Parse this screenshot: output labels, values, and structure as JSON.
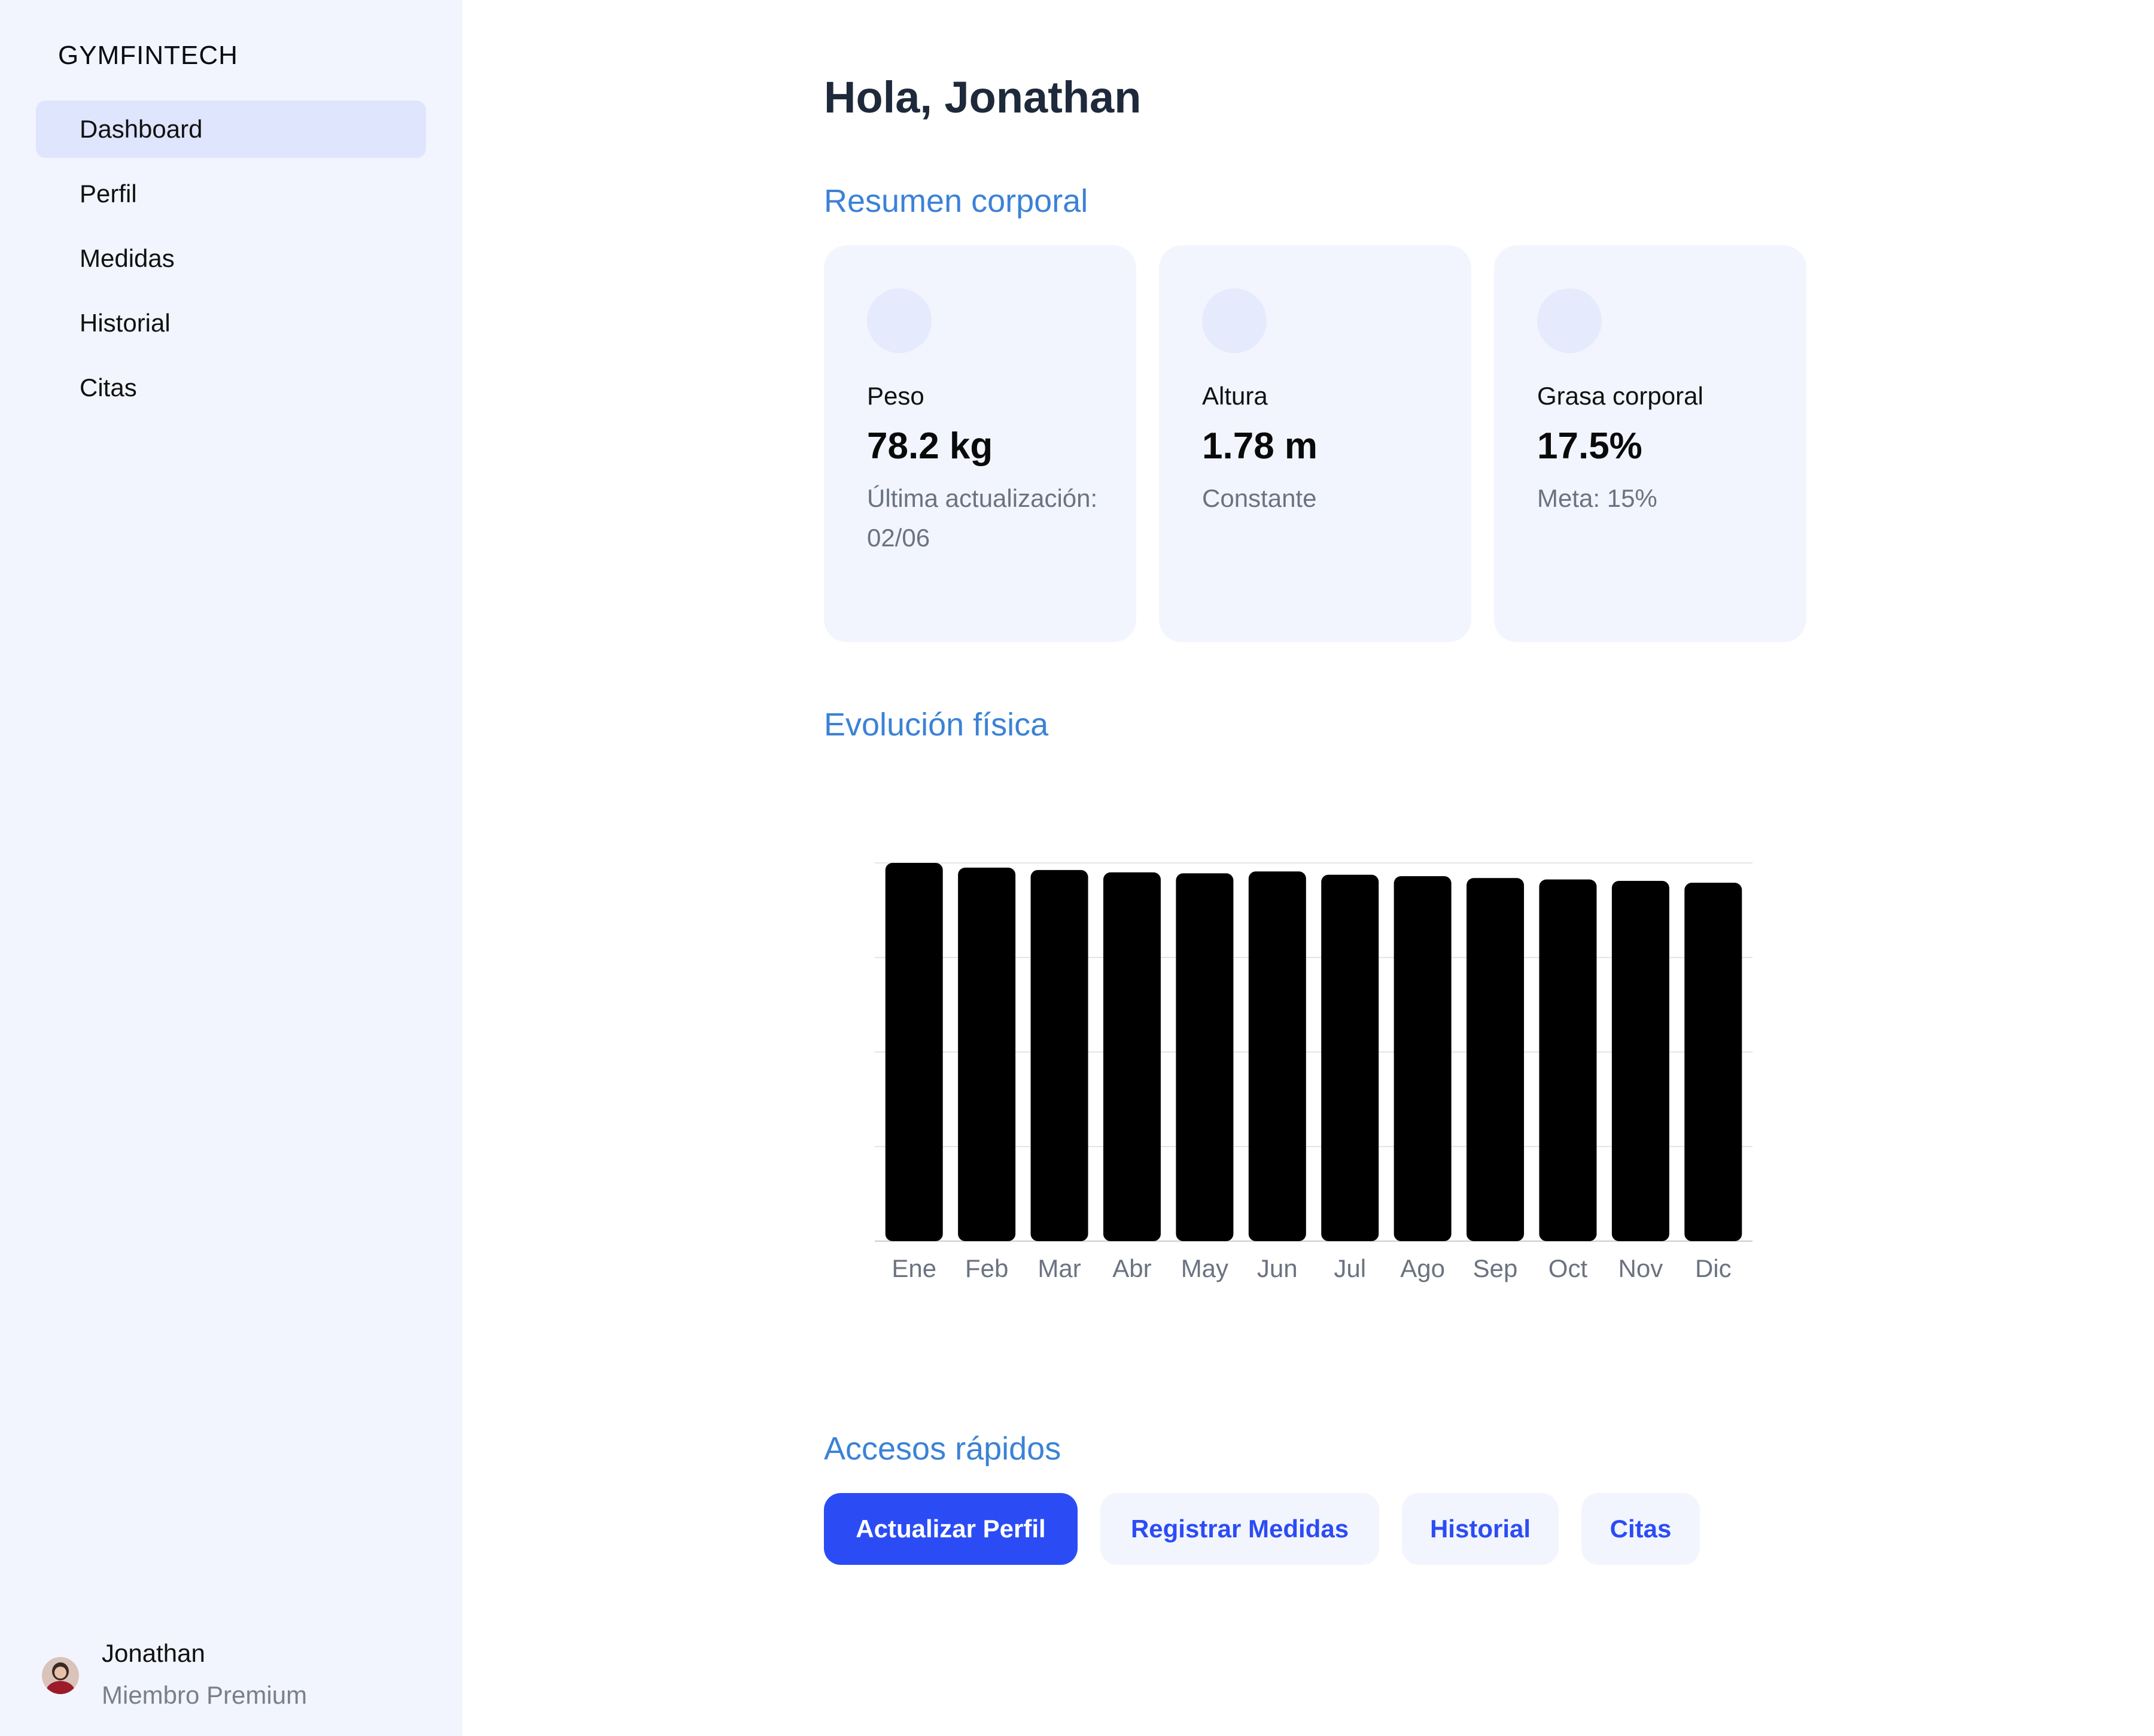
{
  "brand": "GYMFINTECH",
  "sidebar": {
    "items": [
      {
        "label": "Dashboard",
        "active": true
      },
      {
        "label": "Perfil"
      },
      {
        "label": "Medidas"
      },
      {
        "label": "Historial"
      },
      {
        "label": "Citas"
      }
    ],
    "user": {
      "name": "Jonathan",
      "role": "Miembro Premium"
    }
  },
  "main": {
    "greeting": "Hola, Jonathan",
    "summary_title": "Resumen corporal",
    "cards": [
      {
        "label": "Peso",
        "value": "78.2 kg",
        "note": "Última actualización: 02/06"
      },
      {
        "label": "Altura",
        "value": "1.78 m",
        "note": "Constante"
      },
      {
        "label": "Grasa corporal",
        "value": "17.5%",
        "note": "Meta: 15%"
      }
    ],
    "evolution_title": "Evolución física",
    "quick_title": "Accesos rápidos",
    "quick_actions": [
      {
        "label": "Actualizar Perfil"
      },
      {
        "label": "Registrar Medidas"
      },
      {
        "label": "Historial"
      },
      {
        "label": "Citas"
      }
    ]
  },
  "colors": {
    "accent": "#2b4cf5",
    "section_title": "#3b82d6",
    "sidebar_bg": "#f2f5fe",
    "active_nav": "#dfe5fd",
    "bar": "#000000"
  },
  "chart_data": {
    "type": "bar",
    "categories": [
      "Ene",
      "Feb",
      "Mar",
      "Abr",
      "May",
      "Jun",
      "Jul",
      "Ago",
      "Sep",
      "Oct",
      "Nov",
      "Dic"
    ],
    "values": [
      80,
      79,
      78.5,
      78,
      77.8,
      78.2,
      77.5,
      77.2,
      76.8,
      76.5,
      76.2,
      75.8
    ],
    "ylim": [
      0,
      80
    ],
    "grid": true,
    "title": "",
    "xlabel": "",
    "ylabel": ""
  }
}
